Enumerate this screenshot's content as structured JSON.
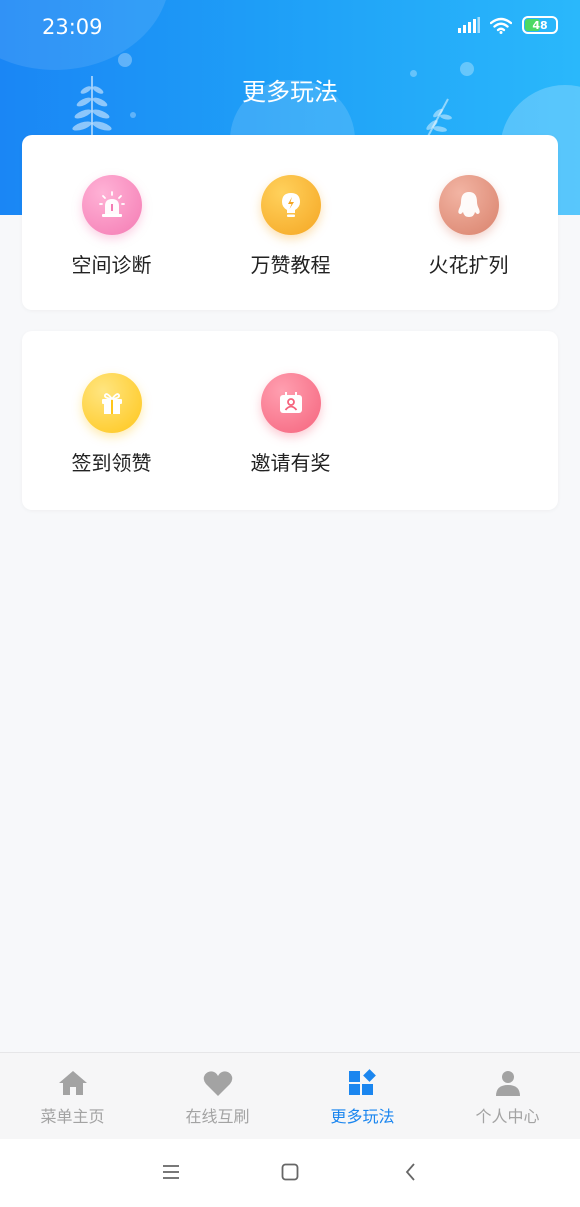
{
  "status_bar": {
    "time": "23:09",
    "battery_level": "48"
  },
  "header": {
    "title": "更多玩法"
  },
  "features_row1": [
    {
      "label": "空间诊断",
      "icon": "alarm-icon",
      "color": "#f47bb3"
    },
    {
      "label": "万赞教程",
      "icon": "lightbulb-icon",
      "color": "#f5a623"
    },
    {
      "label": "火花扩列",
      "icon": "penguin-icon",
      "color": "#d9826c"
    }
  ],
  "features_row2": [
    {
      "label": "签到领赞",
      "icon": "gift-icon",
      "color": "#ffc61a"
    },
    {
      "label": "邀请有奖",
      "icon": "invite-card-icon",
      "color": "#f5647d"
    }
  ],
  "tabbar": {
    "active_color": "#1b86ef",
    "items": [
      {
        "label": "菜单主页",
        "icon": "home-icon"
      },
      {
        "label": "在线互刷",
        "icon": "heart-icon"
      },
      {
        "label": "更多玩法",
        "icon": "apps-icon",
        "active": true
      },
      {
        "label": "个人中心",
        "icon": "person-icon"
      }
    ]
  },
  "navbar": {
    "buttons": [
      "menu-icon",
      "home-square-icon",
      "back-icon"
    ]
  }
}
